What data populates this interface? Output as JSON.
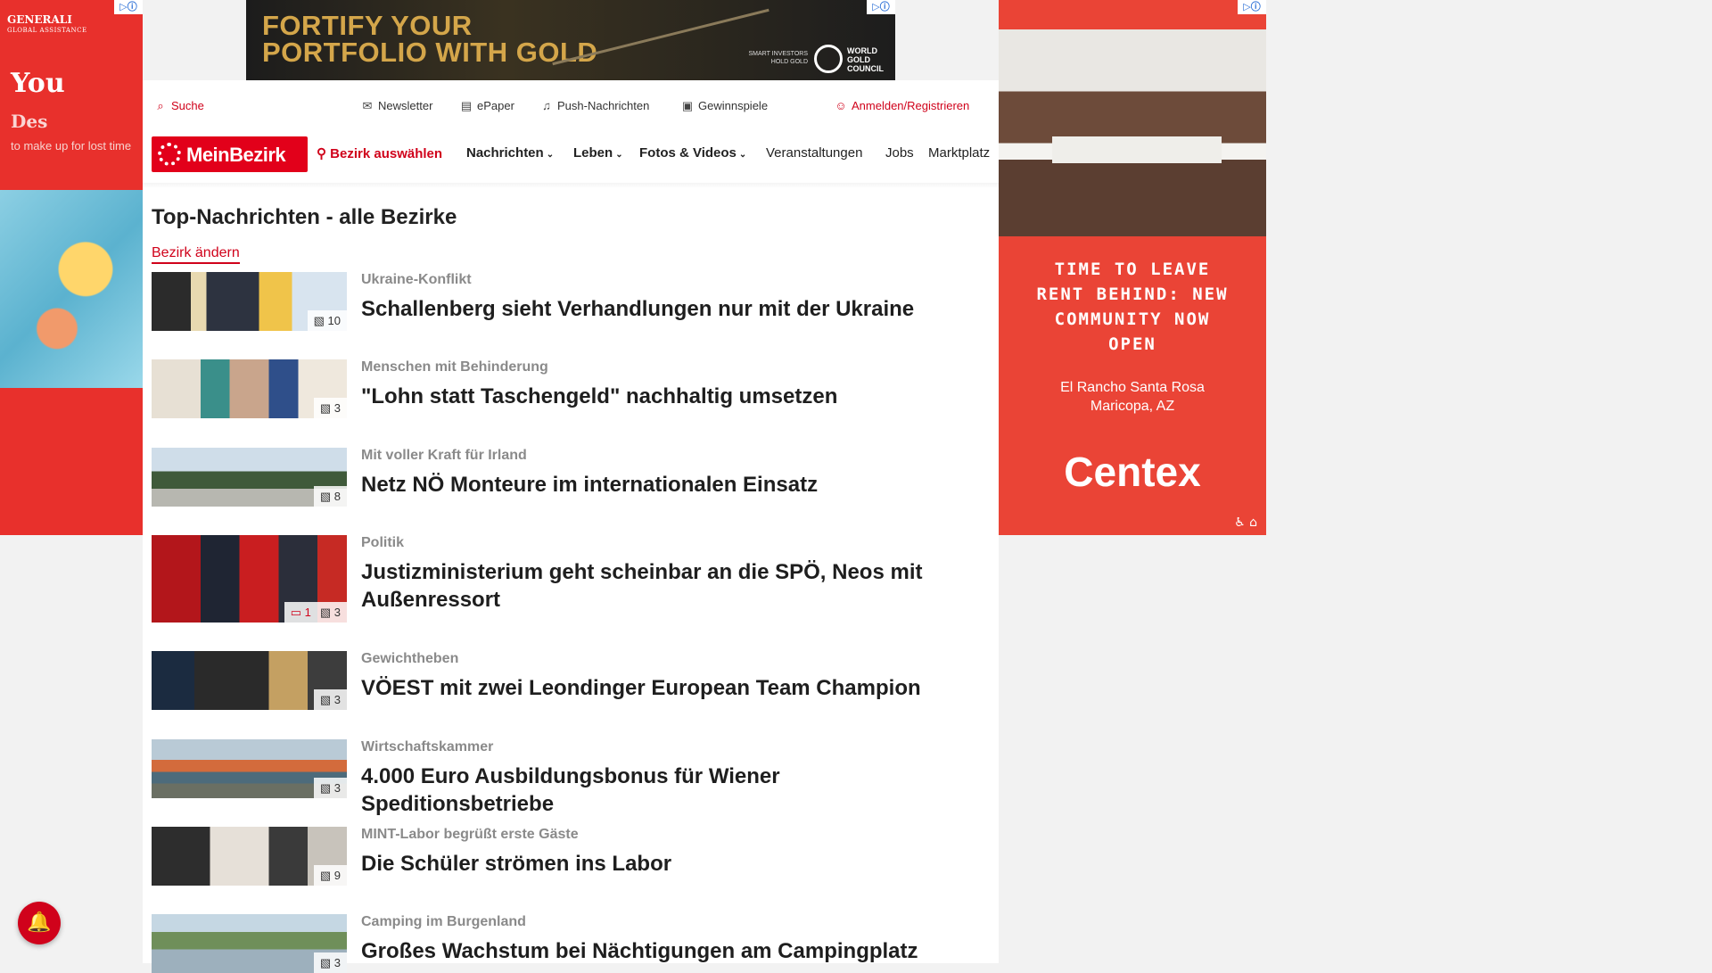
{
  "ads": {
    "left": {
      "logo": "GENERALI",
      "logo_sub": "GLOBAL ASSISTANCE",
      "headline": "You",
      "headline2": "Des",
      "tagline": "to make up for lost time",
      "adchoice": "▷ⓘ"
    },
    "top": {
      "headline_line1": "FORTIFY YOUR",
      "headline_line2": "PORTFOLIO WITH GOLD",
      "small_text": "SMART INVESTORS HOLD GOLD",
      "brand": "WORLD GOLD COUNCIL",
      "adchoice": "▷ⓘ"
    },
    "right": {
      "text": "TIME TO LEAVE RENT BEHIND: NEW COMMUNITY NOW OPEN",
      "location_line1": "El Rancho Santa Rosa",
      "location_line2": "Maricopa, AZ",
      "brand": "Centex",
      "adchoice": "▷ⓘ",
      "accessibility": "♿ ⌂"
    }
  },
  "toplinks": {
    "search": "Suche",
    "newsletter": "Newsletter",
    "epaper": "ePaper",
    "push": "Push-Nachrichten",
    "contests": "Gewinnspiele",
    "login": "Anmelden/Registrieren"
  },
  "nav": {
    "logo": "MeinBezirk",
    "district": "Bezirk auswählen",
    "news": "Nachrichten",
    "life": "Leben",
    "media": "Fotos & Videos",
    "events": "Veranstaltungen",
    "jobs": "Jobs",
    "market": "Marktplatz"
  },
  "page": {
    "title": "Top-Nachrichten - alle Bezirke",
    "change_district": "Bezirk ändern"
  },
  "articles": [
    {
      "kicker": "Ukraine-Konflikt",
      "headline": "Schallenberg sieht Verhandlungen nur mit der Ukraine",
      "images": "10",
      "comments": ""
    },
    {
      "kicker": "Menschen mit Behinderung",
      "headline": "\"Lohn statt Taschengeld\" nachhaltig umsetzen",
      "images": "3",
      "comments": ""
    },
    {
      "kicker": "Mit voller Kraft für Irland",
      "headline": "Netz NÖ Monteure im internationalen Einsatz",
      "images": "8",
      "comments": ""
    },
    {
      "kicker": "Politik",
      "headline": "Justizministerium geht scheinbar an die SPÖ, Neos mit Außenressort",
      "images": "3",
      "comments": "1"
    },
    {
      "kicker": "Gewichtheben",
      "headline": "VÖEST mit zwei Leondinger European Team Champion",
      "images": "3",
      "comments": ""
    },
    {
      "kicker": "Wirtschaftskammer",
      "headline": "4.000 Euro Ausbildungsbonus für Wiener Speditionsbetriebe",
      "images": "3",
      "comments": ""
    },
    {
      "kicker": "MINT-Labor begrüßt erste Gäste",
      "headline": "Die Schüler strömen ins Labor",
      "images": "9",
      "comments": ""
    },
    {
      "kicker": "Camping im Burgenland",
      "headline": "Großes Wachstum bei Nächtigungen am Campingplatz",
      "images": "3",
      "comments": ""
    }
  ],
  "icons": {
    "search": "search-icon",
    "newsletter": "mail-icon",
    "epaper": "newspaper-icon",
    "push": "bell-icon",
    "contests": "gift-icon",
    "login": "user-icon",
    "location": "map-pin-icon",
    "images": "image-icon",
    "comments": "comment-icon",
    "notification": "notification-bell-icon"
  },
  "colors": {
    "brand_red": "#e2001a",
    "link_red": "#d0021b",
    "kicker_gray": "#8a8a8a"
  }
}
